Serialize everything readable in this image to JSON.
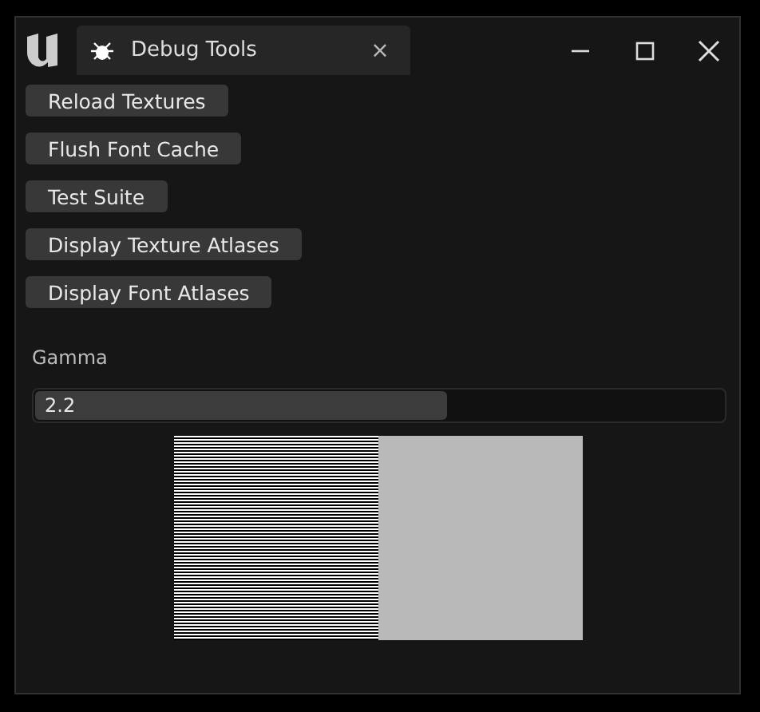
{
  "window": {
    "tab_title": "Debug Tools",
    "tab_close": "×"
  },
  "buttons": [
    "Reload Textures",
    "Flush Font Cache",
    "Test Suite",
    "Display Texture Atlases",
    "Display Font Atlases"
  ],
  "gamma": {
    "label": "Gamma",
    "value": "2.2",
    "level": 0.6
  }
}
